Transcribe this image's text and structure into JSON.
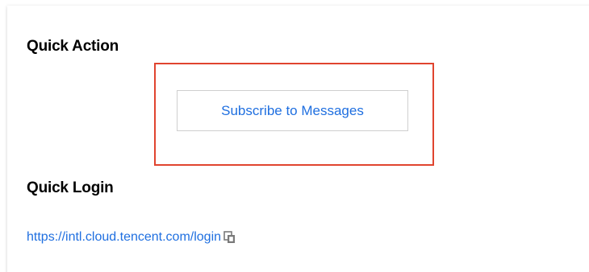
{
  "quick_action": {
    "title": "Quick Action",
    "subscribe_button_label": "Subscribe to Messages"
  },
  "quick_login": {
    "title": "Quick Login",
    "url": "https://intl.cloud.tencent.com/login",
    "copy_icon": "copy-icon"
  },
  "colors": {
    "link": "#1f6fe0",
    "highlight_border": "#e0442f",
    "button_border": "#cfcfcf"
  }
}
